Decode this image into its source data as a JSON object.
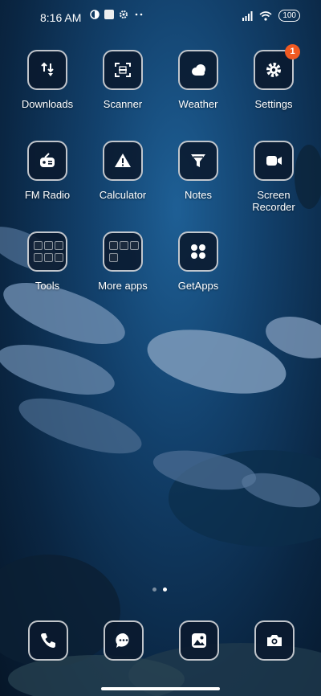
{
  "status": {
    "time": "8:16 AM",
    "battery": "100"
  },
  "rows": [
    [
      {
        "label": "Downloads",
        "icon": "downloads-icon"
      },
      {
        "label": "Scanner",
        "icon": "scanner-icon"
      },
      {
        "label": "Weather",
        "icon": "weather-icon"
      },
      {
        "label": "Settings",
        "icon": "settings-icon",
        "badge": "1"
      }
    ],
    [
      {
        "label": "FM Radio",
        "icon": "radio-icon"
      },
      {
        "label": "Calculator",
        "icon": "calculator-icon"
      },
      {
        "label": "Notes",
        "icon": "notes-icon"
      },
      {
        "label": "Screen Recorder",
        "icon": "screen-recorder-icon"
      }
    ],
    [
      {
        "label": "Tools",
        "icon": "folder-icon"
      },
      {
        "label": "More apps",
        "icon": "folder-icon"
      },
      {
        "label": "GetApps",
        "icon": "getapps-icon"
      }
    ]
  ],
  "dock": [
    "phone-icon",
    "messages-icon",
    "gallery-icon",
    "camera-icon"
  ],
  "colors": {
    "badge": "#f05a22",
    "icon_bg": "#0a192d"
  }
}
